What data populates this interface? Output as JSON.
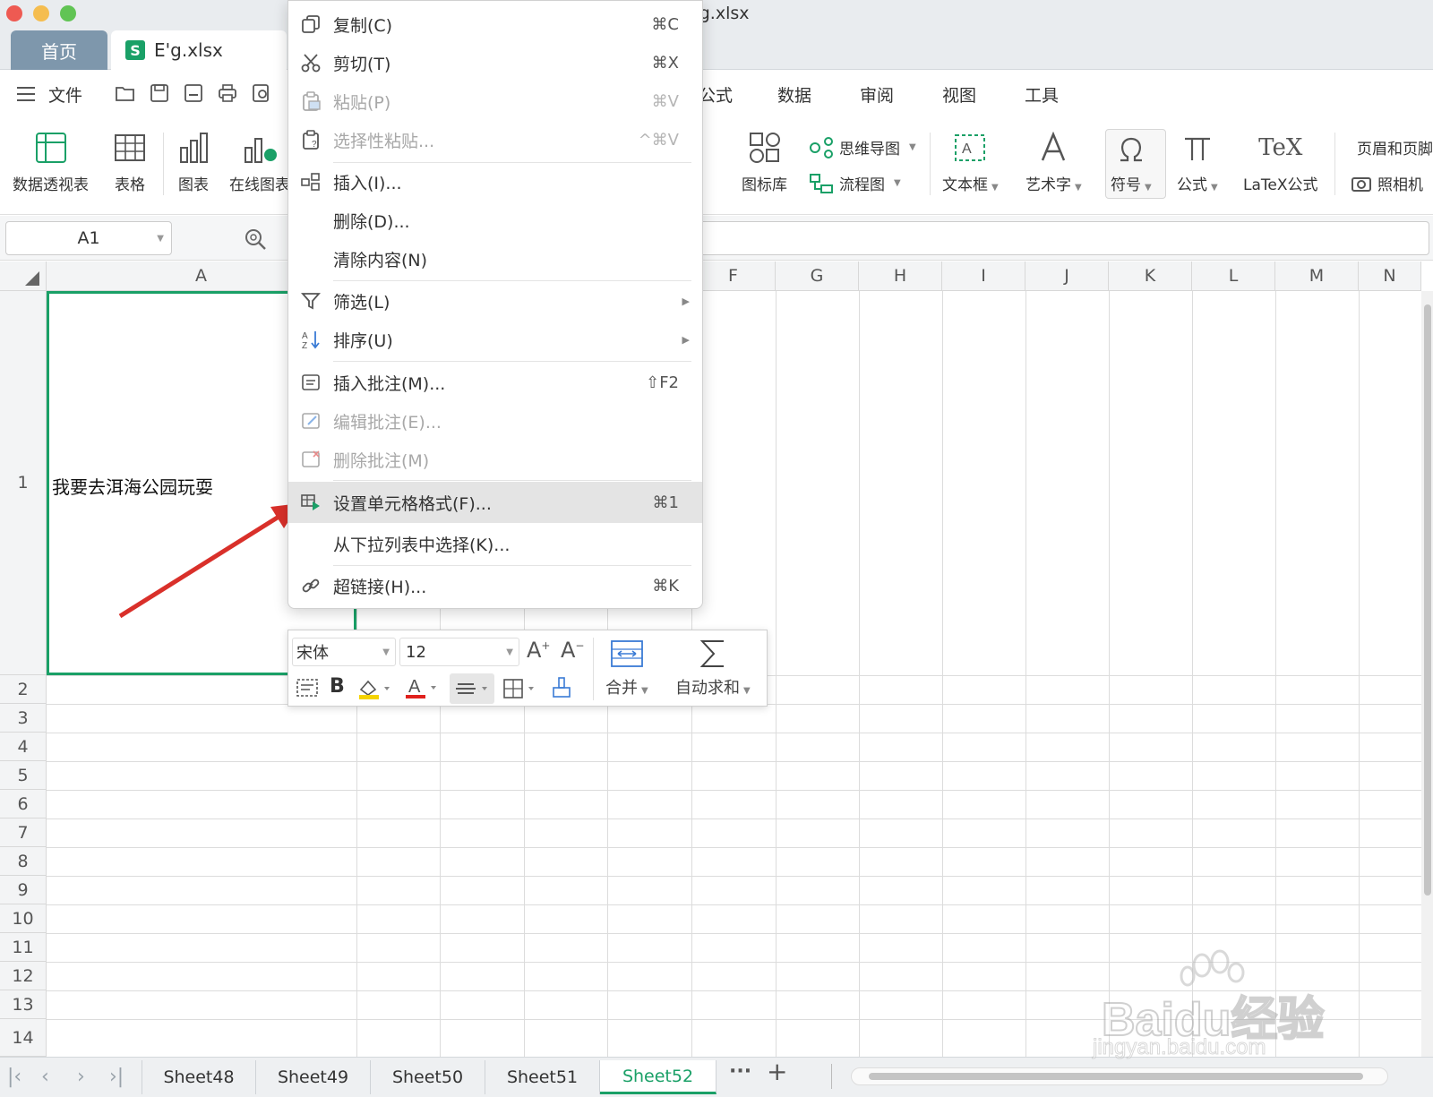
{
  "window": {
    "title": "E'g.xlsx"
  },
  "tabs": {
    "home": "首页",
    "file": "E'g.xlsx",
    "file_icon": "S"
  },
  "menubar": {
    "file": "文件",
    "formula": "公式",
    "data": "数据",
    "review": "审阅",
    "view": "视图",
    "tools": "工具"
  },
  "ribbon": {
    "pivot": "数据透视表",
    "table": "表格",
    "chart": "图表",
    "online_chart": "在线图表",
    "icon_lib": "图标库",
    "mindmap": "思维导图",
    "flowchart": "流程图",
    "textbox": "文本框",
    "wordart": "艺术字",
    "symbol": "符号",
    "formula": "公式",
    "latex": "LaTeX公式",
    "latex_icon": "TeX",
    "header_footer": "页眉和页脚",
    "camera": "照相机"
  },
  "namebox": {
    "value": "A1"
  },
  "columns": [
    "A",
    "F",
    "G",
    "H",
    "I",
    "J",
    "K",
    "L",
    "M",
    "N"
  ],
  "rows": [
    "1",
    "2",
    "3",
    "4",
    "5",
    "6",
    "7",
    "8",
    "9",
    "10",
    "11",
    "12",
    "13",
    "14"
  ],
  "cell_a1": "我要去洱海公园玩耍",
  "context_menu": {
    "copy": {
      "label": "复制(C)",
      "shortcut": "⌘C"
    },
    "cut": {
      "label": "剪切(T)",
      "shortcut": "⌘X"
    },
    "paste": {
      "label": "粘贴(P)",
      "shortcut": "⌘V"
    },
    "paste_special": {
      "label": "选择性粘贴...",
      "shortcut": "^⌘V"
    },
    "insert": {
      "label": "插入(I)..."
    },
    "delete": {
      "label": "删除(D)..."
    },
    "clear": {
      "label": "清除内容(N)"
    },
    "filter": {
      "label": "筛选(L)"
    },
    "sort": {
      "label": "排序(U)"
    },
    "insert_comment": {
      "label": "插入批注(M)...",
      "shortcut": "⇧F2"
    },
    "edit_comment": {
      "label": "编辑批注(E)..."
    },
    "delete_comment": {
      "label": "删除批注(M)"
    },
    "format_cells": {
      "label": "设置单元格格式(F)...",
      "shortcut": "⌘1"
    },
    "pick_list": {
      "label": "从下拉列表中选择(K)..."
    },
    "hyperlink": {
      "label": "超链接(H)...",
      "shortcut": "⌘K"
    }
  },
  "mini_toolbar": {
    "font": "宋体",
    "size": "12",
    "merge": "合并",
    "autosum": "自动求和",
    "bold": "B",
    "font_color_glyph": "A",
    "grow": "A",
    "shrink": "A"
  },
  "sheets": [
    "Sheet48",
    "Sheet49",
    "Sheet50",
    "Sheet51",
    "Sheet52"
  ],
  "active_sheet": "Sheet52",
  "sheet_more": "···",
  "sheet_add": "+",
  "watermark": {
    "brand_latin": "Bai",
    "brand_du": "du",
    "brand_cn": "经验",
    "url": "jingyan.baidu.com"
  },
  "colors": {
    "accent": "#1aa067",
    "arrow": "#d9302a",
    "close": "#ee5a52",
    "min": "#f5bd4f",
    "max": "#61c454"
  }
}
